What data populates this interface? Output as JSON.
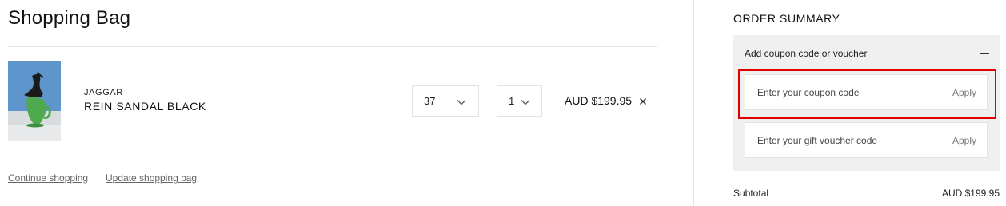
{
  "bag": {
    "title": "Shopping Bag",
    "item": {
      "brand": "JAGGAR",
      "name": "REIN SANDAL BLACK",
      "size": "37",
      "quantity": "1",
      "price": "AUD $199.95",
      "remove_icon": "close-icon"
    },
    "links": {
      "continue": "Continue shopping",
      "update": "Update shopping bag"
    }
  },
  "summary": {
    "title": "ORDER SUMMARY",
    "coupon_toggle_label": "Add coupon code or voucher",
    "coupon_placeholder": "Enter your coupon code",
    "voucher_placeholder": "Enter your gift voucher code",
    "apply_label": "Apply",
    "subtotal_label": "Subtotal",
    "subtotal_value": "AUD $199.95"
  },
  "colors": {
    "highlight": "#e00000",
    "panel_bg": "#f0f0f0",
    "divider": "#e4e4e4"
  }
}
